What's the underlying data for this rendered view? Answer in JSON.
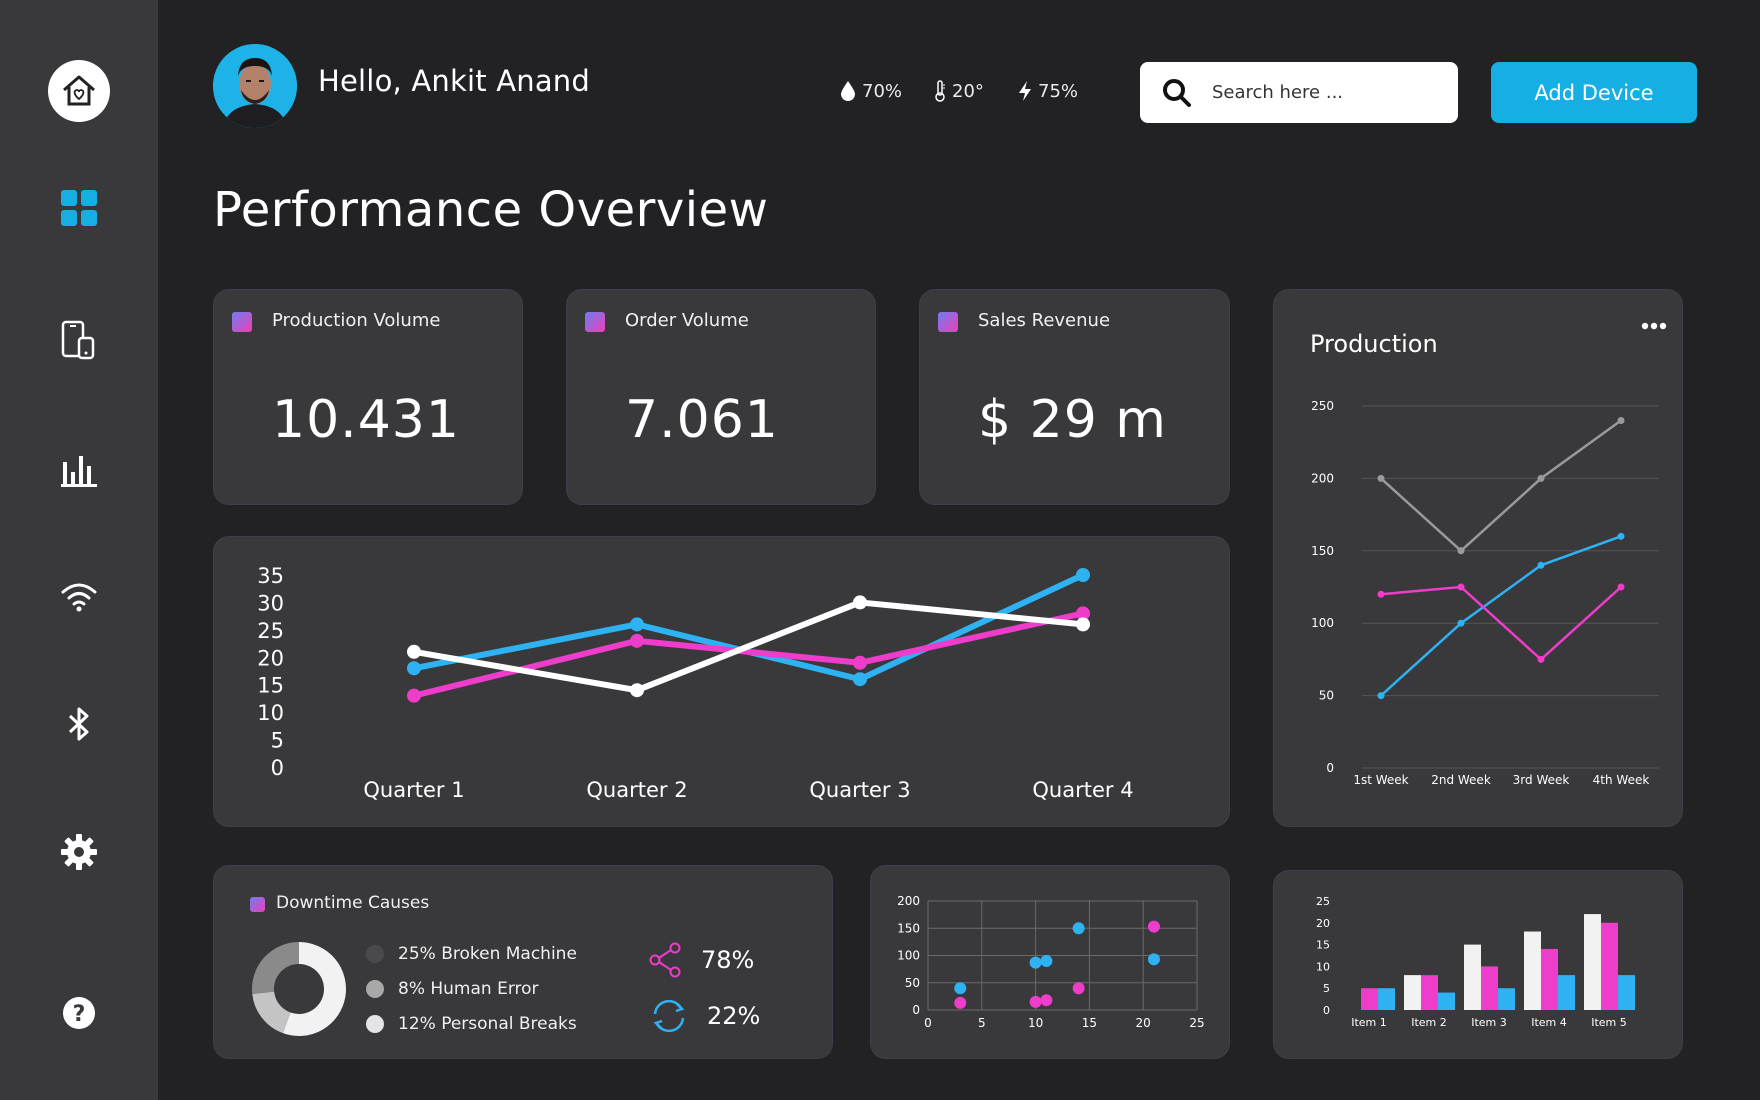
{
  "header": {
    "greeting": "Hello, Ankit Anand",
    "humidity": "70%",
    "temperature": "20°",
    "power": "75%",
    "search_placeholder": "Search here ...",
    "add_device_label": "Add Device"
  },
  "sidebar": {
    "items": [
      {
        "icon": "smart-home-icon"
      },
      {
        "icon": "dashboard-grid-icon",
        "active": true
      },
      {
        "icon": "devices-icon"
      },
      {
        "icon": "bar-chart-icon"
      },
      {
        "icon": "wifi-icon"
      },
      {
        "icon": "bluetooth-icon"
      },
      {
        "icon": "settings-gear-icon"
      },
      {
        "icon": "help-icon"
      }
    ]
  },
  "page_title": "Performance Overview",
  "kpis": [
    {
      "label": "Production Volume",
      "value": "10.431"
    },
    {
      "label": "Order Volume",
      "value": "7.061"
    },
    {
      "label": "Sales Revenue",
      "value": "$ 29 m"
    }
  ],
  "downtime": {
    "title": "Downtime Causes",
    "items": [
      {
        "label": "25% Broken Machine",
        "color": "#4a4a4c"
      },
      {
        "label": "8% Human Error",
        "color": "#a8a8a8"
      },
      {
        "label": "12% Personal Breaks",
        "color": "#e4e4e4"
      }
    ],
    "share_value": "78%",
    "sync_value": "22%"
  },
  "colors": {
    "accent": "#15afe4",
    "blue": "#2fb2f2",
    "pink": "#ee3ccb",
    "white": "#ffffff",
    "gray": "#9a9a9a",
    "card": "#39393b",
    "background": "#222224"
  },
  "chart_data": [
    {
      "type": "line",
      "categories": [
        "Quarter 1",
        "Quarter 2",
        "Quarter 3",
        "Quarter 4"
      ],
      "ylim": [
        0,
        35
      ],
      "yticks": [
        0,
        5,
        10,
        15,
        20,
        25,
        30,
        35
      ],
      "series": [
        {
          "color": "#2fb2f2",
          "values": [
            18,
            26,
            16,
            35
          ]
        },
        {
          "color": "#ee3ccb",
          "values": [
            13,
            23,
            19,
            28
          ]
        },
        {
          "color": "#ffffff",
          "values": [
            21,
            14,
            30,
            26
          ]
        }
      ]
    },
    {
      "type": "line",
      "title": "Production",
      "categories": [
        "1st Week",
        "2nd Week",
        "3rd Week",
        "4th Week"
      ],
      "ylim": [
        0,
        250
      ],
      "yticks": [
        0,
        50,
        100,
        150,
        200,
        250
      ],
      "grid": true,
      "series": [
        {
          "color": "#9a9a9a",
          "values": [
            200,
            150,
            200,
            240
          ]
        },
        {
          "color": "#2fb2f2",
          "values": [
            50,
            100,
            140,
            160
          ]
        },
        {
          "color": "#ee3ccb",
          "values": [
            120,
            125,
            75,
            125
          ]
        }
      ]
    },
    {
      "type": "pie",
      "donut": true,
      "values": [
        25,
        8,
        12
      ],
      "colors": [
        "#f2f2f2",
        "#c4c4c4",
        "#8a8a8a"
      ]
    },
    {
      "type": "scatter",
      "xlim": [
        0,
        25
      ],
      "ylim": [
        0,
        200
      ],
      "xticks": [
        0,
        5,
        10,
        15,
        20,
        25
      ],
      "yticks": [
        0,
        50,
        100,
        150,
        200
      ],
      "grid": true,
      "series": [
        {
          "color": "#2fb2f2",
          "points": [
            [
              3,
              40
            ],
            [
              10,
              87
            ],
            [
              11,
              90
            ],
            [
              14,
              150
            ],
            [
              21,
              93
            ]
          ]
        },
        {
          "color": "#ee3ccb",
          "points": [
            [
              3,
              13
            ],
            [
              10,
              15
            ],
            [
              11,
              18
            ],
            [
              14,
              40
            ],
            [
              21,
              153
            ]
          ]
        }
      ]
    },
    {
      "type": "bar",
      "categories": [
        "Item 1",
        "Item 2",
        "Item 3",
        "Item 4",
        "Item 5"
      ],
      "ylim": [
        0,
        25
      ],
      "yticks": [
        0,
        5,
        10,
        15,
        20,
        25
      ],
      "series": [
        {
          "color": "#f2f2f2",
          "values": [
            0,
            8,
            15,
            18,
            22
          ]
        },
        {
          "color": "#ee3ccb",
          "values": [
            5,
            8,
            10,
            14,
            20
          ]
        },
        {
          "color": "#2fb2f2",
          "values": [
            5,
            4,
            5,
            8,
            8
          ]
        }
      ]
    }
  ]
}
